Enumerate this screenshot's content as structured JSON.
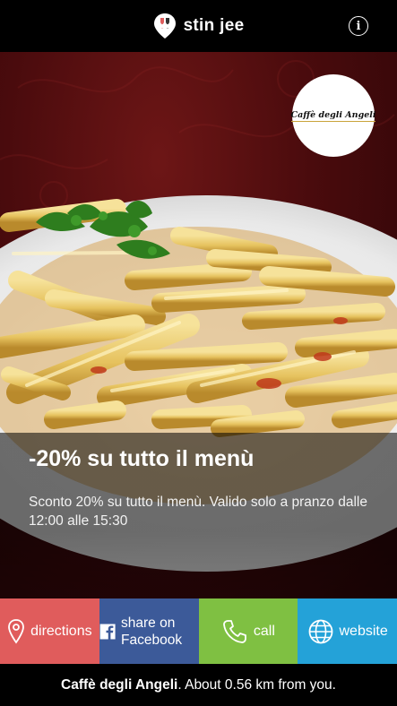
{
  "app": {
    "brand_name": "stin jee",
    "logo_icon": "wine-glass-pin-icon",
    "info_icon": "info-icon",
    "info_glyph": "i"
  },
  "venue": {
    "logo_text": "Caffè degli Angeli"
  },
  "offer": {
    "title": "-20% su tutto il menù",
    "description": "Sconto 20% su tutto il menù. Valido solo a pranzo dalle 12:00 alle 15:30"
  },
  "actions": [
    {
      "label": "directions",
      "icon": "map-pin-icon",
      "color": "#e05c5c"
    },
    {
      "label": "share on Facebook",
      "icon": "facebook-icon",
      "color": "#3c5a99"
    },
    {
      "label": "call",
      "icon": "phone-icon",
      "color": "#7fc042"
    },
    {
      "label": "website",
      "icon": "globe-icon",
      "color": "#24a2d8"
    }
  ],
  "footer": {
    "venue_name": "Caffè degli Angeli",
    "distance_text": ". About 0.56 km from you."
  }
}
